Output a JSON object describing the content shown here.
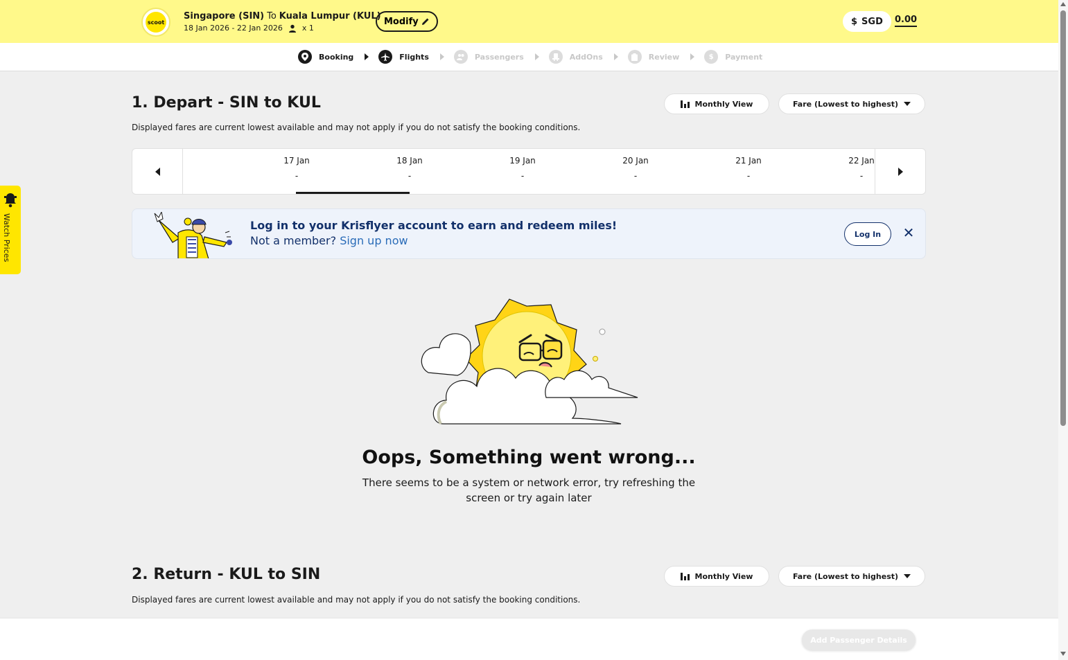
{
  "header": {
    "logo_text": "scoot",
    "origin": "Singapore (SIN)",
    "to_label": "To",
    "destination": "Kuala Lumpur (KUL)",
    "dates": "18 Jan 2026 - 22 Jan 2026",
    "passenger_count": "x 1",
    "modify_label": "Modify",
    "currency_label": "SGD",
    "currency_symbol": "$",
    "total": "0.00"
  },
  "steps": [
    {
      "label": "Booking",
      "icon": "map-pin-icon",
      "active": true
    },
    {
      "label": "Flights",
      "icon": "plane-icon",
      "active": true
    },
    {
      "label": "Passengers",
      "icon": "passengers-icon",
      "active": false
    },
    {
      "label": "AddOns",
      "icon": "seat-icon",
      "active": false
    },
    {
      "label": "Review",
      "icon": "clipboard-icon",
      "active": false
    },
    {
      "label": "Payment",
      "icon": "dollar-icon",
      "active": false
    }
  ],
  "depart": {
    "title": "1. Depart - SIN to KUL",
    "subtitle": "Displayed fares are current lowest available and may not apply if you do not satisfy the booking conditions.",
    "monthly_view_label": "Monthly View",
    "sort_label": "Fare (Lowest to highest)",
    "dates": [
      {
        "date": "17 Jan",
        "price": "-",
        "selected": false
      },
      {
        "date": "18 Jan",
        "price": "-",
        "selected": true
      },
      {
        "date": "19 Jan",
        "price": "-",
        "selected": false
      },
      {
        "date": "20 Jan",
        "price": "-",
        "selected": false
      },
      {
        "date": "21 Jan",
        "price": "-",
        "selected": false
      },
      {
        "date": "22 Jan",
        "price": "-",
        "selected": false
      }
    ]
  },
  "krisflyer": {
    "title": "Log in to your Krisflyer account to earn and redeem miles!",
    "not_member": "Not a member?",
    "signup_label": "Sign up now",
    "login_label": "Log In"
  },
  "error": {
    "title": "Oops, Something went wrong...",
    "message": "There seems to be a system or network error, try refreshing the screen or try again later"
  },
  "return": {
    "title": "2. Return - KUL to SIN",
    "subtitle": "Displayed fares are current lowest available and may not apply if you do not satisfy the booking conditions.",
    "monthly_view_label": "Monthly View",
    "sort_label": "Fare (Lowest to highest)"
  },
  "watch_prices_label": "Watch Prices",
  "footer": {
    "add_passenger_label": "Add Passenger Details"
  },
  "colors": {
    "header_bg": "#fff98a",
    "brand_yellow": "#ffe600",
    "navy": "#12306a",
    "page_bg": "#efefef"
  }
}
